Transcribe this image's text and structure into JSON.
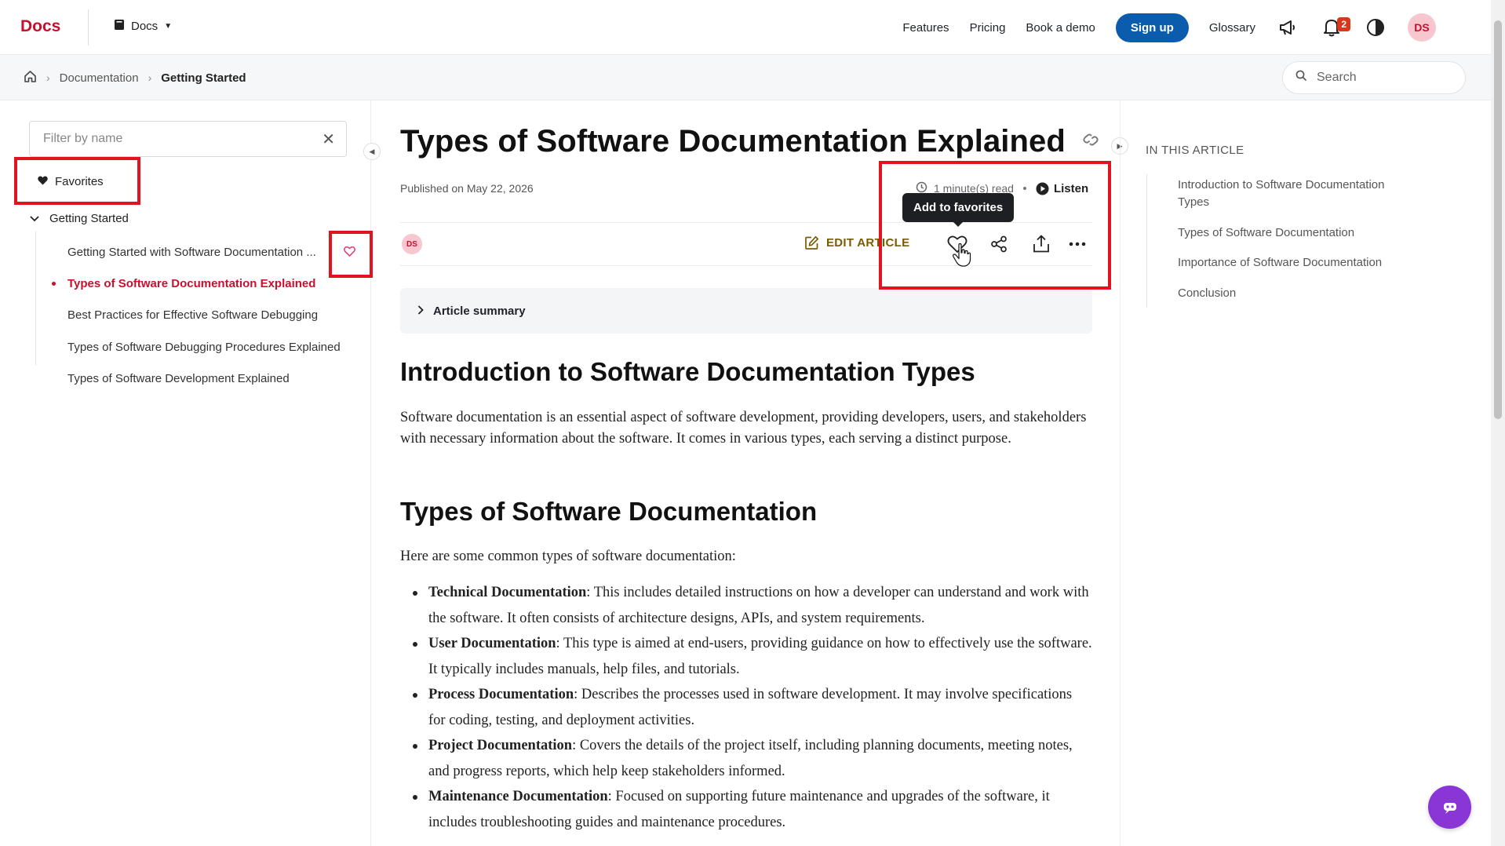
{
  "header": {
    "logo": "Docs",
    "project_label": "Docs",
    "nav": [
      "Features",
      "Pricing",
      "Book a demo"
    ],
    "signup_label": "Sign up",
    "glossary_label": "Glossary",
    "notification_count": "2",
    "avatar_initials": "DS"
  },
  "breadcrumb": {
    "items": [
      "Documentation",
      "Getting Started"
    ]
  },
  "search": {
    "placeholder": "Search"
  },
  "sidebar": {
    "filter_placeholder": "Filter by name",
    "favorites_label": "Favorites",
    "group_label": "Getting Started",
    "items": [
      "Getting Started with Software Documentation ...",
      "Types of Software Documentation Explained",
      "Best Practices for Effective Software Debugging",
      "Types of Software Debugging Procedures Explained",
      "Types of Software Development Explained"
    ]
  },
  "article": {
    "title": "Types of Software Documentation Explained",
    "published": "Published on May 22, 2026",
    "read_time": "1 minute(s) read",
    "listen_label": "Listen",
    "tooltip": "Add to favorites",
    "author_initials": "DS",
    "edit_label": "EDIT ARTICLE",
    "summary_label": "Article summary",
    "section1_heading": "Introduction to Software Documentation Types",
    "section1_text": "Software documentation is an essential aspect of software development, providing developers, users, and stakeholders with necessary information about the software. It comes in various types, each serving a distinct purpose.",
    "section2_heading": "Types of Software Documentation",
    "section2_intro": "Here are some common types of software documentation:",
    "list": [
      {
        "term": "Technical Documentation",
        "text": ": This includes detailed instructions on how a developer can understand and work with the software. It often consists of architecture designs, APIs, and system requirements."
      },
      {
        "term": "User Documentation",
        "text": ": This type is aimed at end-users, providing guidance on how to effectively use the software. It typically includes manuals, help files, and tutorials."
      },
      {
        "term": "Process Documentation",
        "text": ": Describes the processes used in software development. It may involve specifications for coding, testing, and deployment activities."
      },
      {
        "term": "Project Documentation",
        "text": ": Covers the details of the project itself, including planning documents, meeting notes, and progress reports, which help keep stakeholders informed."
      },
      {
        "term": "Maintenance Documentation",
        "text": ": Focused on supporting future maintenance and upgrades of the software, it includes troubleshooting guides and maintenance procedures."
      }
    ]
  },
  "toc": {
    "title": "IN THIS ARTICLE",
    "items": [
      "Introduction to Software Documentation Types",
      "Types of Software Documentation",
      "Importance of Software Documentation",
      "Conclusion"
    ]
  },
  "colors": {
    "brand": "#c8102e",
    "signup": "#0b5cad",
    "highlight_box": "#e0141e",
    "chat_button": "#8a35d6"
  }
}
